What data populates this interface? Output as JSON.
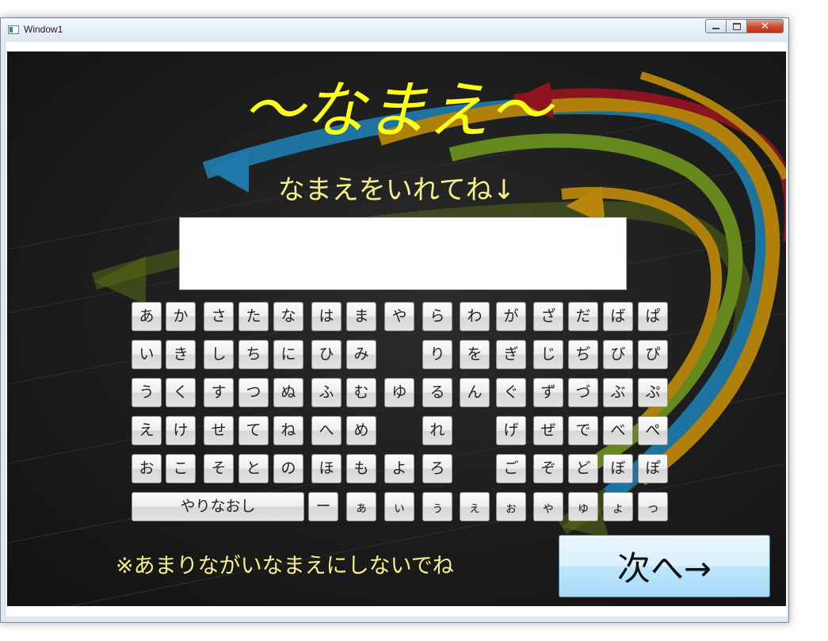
{
  "window": {
    "title": "Window1",
    "buttons": {
      "minimize": "",
      "maximize": "",
      "close": "✕"
    }
  },
  "screen": {
    "title": "～なまえ～",
    "subtitle": "なまえをいれてね↓",
    "name_input": {
      "value": "",
      "placeholder": ""
    },
    "warning": "※あまりながいなまえにしないでね",
    "next_button": "次へ→"
  },
  "keyboard": {
    "rows": [
      [
        "あ",
        "か",
        "さ",
        "た",
        "な",
        "は",
        "ま",
        "や",
        "ら",
        "わ",
        "が",
        "ざ",
        "だ",
        "ば",
        "ぱ"
      ],
      [
        "い",
        "き",
        "し",
        "ち",
        "に",
        "ひ",
        "み",
        "",
        "り",
        "を",
        "ぎ",
        "じ",
        "ぢ",
        "び",
        "ぴ"
      ],
      [
        "う",
        "く",
        "す",
        "つ",
        "ぬ",
        "ふ",
        "む",
        "ゆ",
        "る",
        "ん",
        "ぐ",
        "ず",
        "づ",
        "ぶ",
        "ぷ"
      ],
      [
        "え",
        "け",
        "せ",
        "て",
        "ね",
        "へ",
        "め",
        "",
        "れ",
        "",
        "げ",
        "ぜ",
        "で",
        "べ",
        "ぺ"
      ],
      [
        "お",
        "こ",
        "そ",
        "と",
        "の",
        "ほ",
        "も",
        "よ",
        "ろ",
        "",
        "ご",
        "ぞ",
        "ど",
        "ぼ",
        "ぽ"
      ]
    ],
    "last_row": {
      "clear_label": "やりなおし",
      "keys": [
        "ー",
        "ぁ",
        "ぃ",
        "ぅ",
        "ぇ",
        "ぉ",
        "ゃ",
        "ゅ",
        "ょ",
        "っ"
      ]
    }
  },
  "colors": {
    "title": "#ffff1a",
    "subtitle": "#f5f08a",
    "background": "#1c1c1c",
    "stripe_red": "#8e1420",
    "stripe_orange": "#b8860b",
    "stripe_blue": "#1e78a8",
    "stripe_green": "#6a8f1f"
  }
}
